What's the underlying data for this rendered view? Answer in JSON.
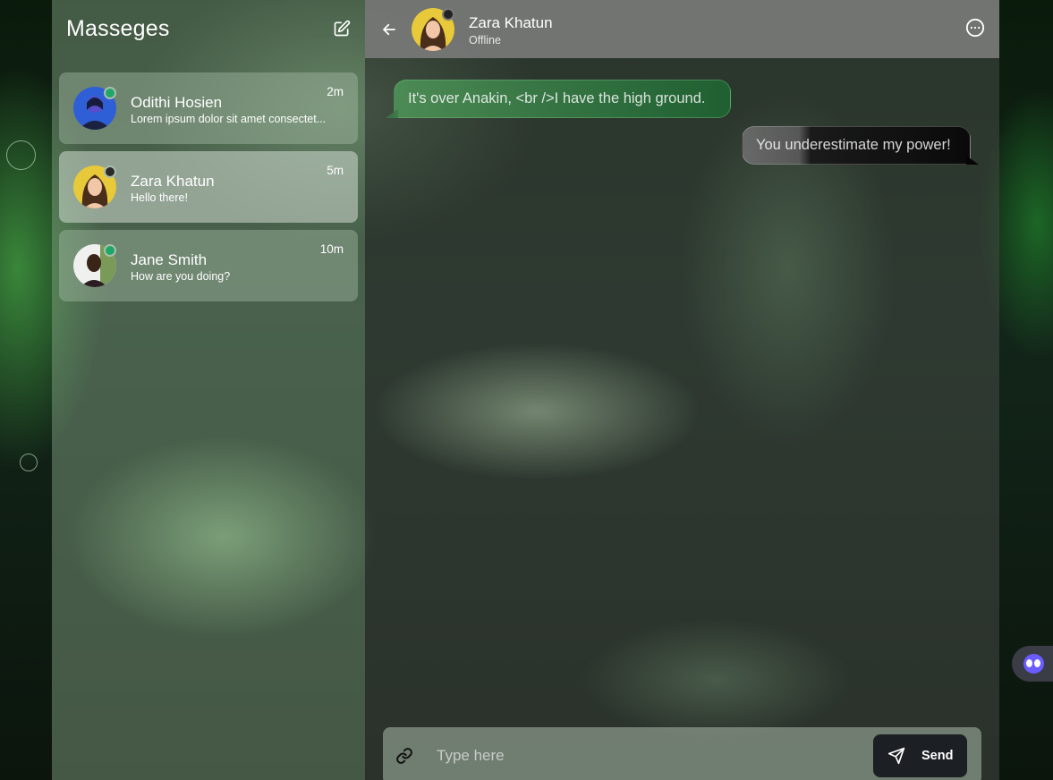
{
  "sidebar": {
    "title": "Masseges",
    "conversations": [
      {
        "name": "Odithi Hosien",
        "preview": "Lorem ipsum dolor sit amet consectet...",
        "time": "2m",
        "status": "online"
      },
      {
        "name": "Zara Khatun",
        "preview": "Hello there!",
        "time": "5m",
        "status": "offline"
      },
      {
        "name": "Jane Smith",
        "preview": "How are you doing?",
        "time": "10m",
        "status": "online"
      }
    ]
  },
  "chat": {
    "contact_name": "Zara Khatun",
    "contact_status": "Offline",
    "messages": [
      {
        "direction": "incoming",
        "text": "It's over Anakin, <br />I have the high ground."
      },
      {
        "direction": "outgoing",
        "text": "You underestimate my power!"
      }
    ]
  },
  "composer": {
    "placeholder": "Type here",
    "send_label": "Send"
  },
  "colors": {
    "online": "#1fa76a",
    "offline": "#2a2a2a",
    "send_button": "#1c1f24",
    "incoming_bubble": "#2e7a45"
  }
}
